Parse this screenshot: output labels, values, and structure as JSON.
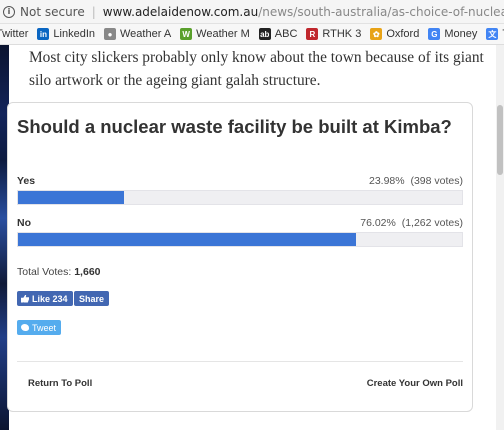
{
  "browser": {
    "security_label": "Not secure",
    "url_host": "www.adelaidenow.com.au",
    "url_path": "/news/south-australia/as-choice-of-nuclear-waste-facility-starts-na"
  },
  "bookmarks": [
    {
      "label": "Twitter",
      "icon": "none"
    },
    {
      "label": "LinkedIn",
      "icon": "linkedin-icon",
      "color": "#0a66c2",
      "glyph": "in"
    },
    {
      "label": "Weather A",
      "icon": "weather-icon",
      "color": "#888888",
      "glyph": "●"
    },
    {
      "label": "Weather M",
      "icon": "weather-icon",
      "color": "#5aa02c",
      "glyph": "W"
    },
    {
      "label": "ABC",
      "icon": "abc-icon",
      "color": "#222222",
      "glyph": "ab"
    },
    {
      "label": "RTHK 3",
      "icon": "rthk-icon",
      "color": "#c0272d",
      "glyph": "R"
    },
    {
      "label": "Oxford",
      "icon": "oxford-icon",
      "color": "#e8a317",
      "glyph": "✿"
    },
    {
      "label": "Money",
      "icon": "google-icon",
      "color": "#4285f4",
      "glyph": "G"
    },
    {
      "label": "Translate",
      "icon": "translate-icon",
      "color": "#4285f4",
      "glyph": "文"
    },
    {
      "label": "ST",
      "icon": "none"
    }
  ],
  "article": {
    "text": "Most city slickers probably only know about the town because of its giant silo artwork or the ageing giant galah structure."
  },
  "poll": {
    "question": "Should a nuclear waste facility be built at Kimba?",
    "options": [
      {
        "label": "Yes",
        "percent_text": "23.98%",
        "votes_text": "(398 votes)",
        "fraction": 0.2398
      },
      {
        "label": "No",
        "percent_text": "76.02%",
        "votes_text": "(1,262 votes)",
        "fraction": 0.7602
      }
    ],
    "total_label": "Total Votes:",
    "total_value": "1,660",
    "like_label": "Like",
    "like_count": "234",
    "share_label": "Share",
    "tweet_label": "Tweet",
    "return_label": "Return To Poll",
    "create_label": "Create Your Own Poll",
    "bar_color": "#3b75d6"
  }
}
